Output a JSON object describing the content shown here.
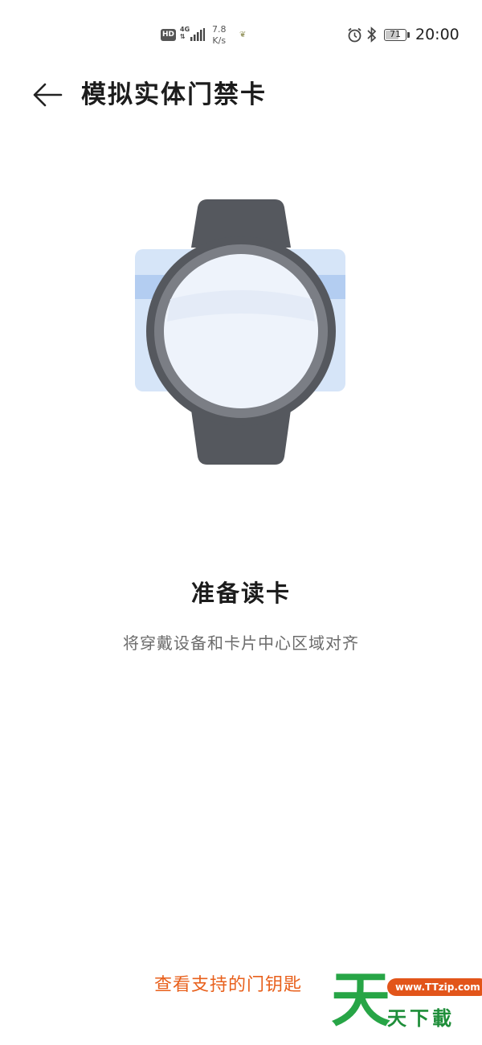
{
  "status_bar": {
    "hd_badge": "HD",
    "network_type": "4G",
    "speed_value": "7.8",
    "speed_unit": "K/s",
    "battery_level": "71",
    "battery_fraction": 0.71,
    "time": "20:00",
    "icons": [
      "signal-icon",
      "leaf-icon",
      "alarm-icon",
      "bluetooth-icon",
      "battery-icon"
    ]
  },
  "header": {
    "back_icon": "back-arrow-icon",
    "title": "模拟实体门禁卡"
  },
  "prompt": {
    "title": "准备读卡",
    "description": "将穿戴设备和卡片中心区域对齐"
  },
  "footer": {
    "link_label": "查看支持的门钥匙"
  },
  "watermark": {
    "big_char": "天",
    "url": "www.TTzip.com",
    "text": "天下載"
  },
  "colors": {
    "accent_link": "#e8601c",
    "watch_body": "#55585e",
    "card": "#d6e5f8",
    "card_stripe": "#b3cdf1",
    "watermark_green": "#27a546"
  }
}
